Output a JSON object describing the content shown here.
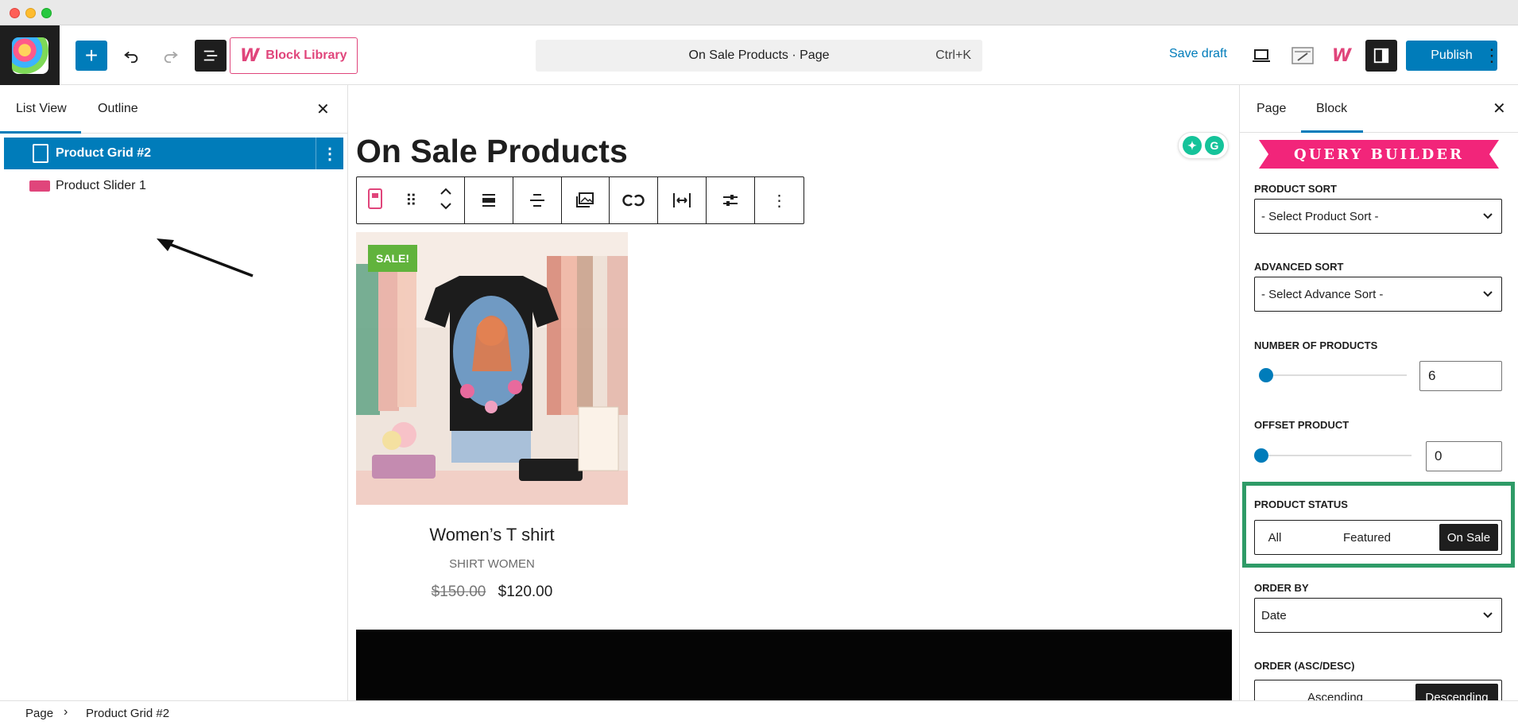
{
  "header": {
    "block_library_label": "Block Library",
    "command_title": "On Sale Products · Page",
    "command_shortcut": "Ctrl+K",
    "save_draft_label": "Save draft",
    "publish_label": "Publish"
  },
  "left_panel": {
    "tabs": [
      "List View",
      "Outline"
    ],
    "items": [
      {
        "label": "Product Grid #2",
        "selected": true
      },
      {
        "label": "Product Slider 1",
        "selected": false
      }
    ]
  },
  "canvas": {
    "page_title": "On Sale Products",
    "product": {
      "badge": "SALE!",
      "name": "Women’s T shirt",
      "categories": "SHIRT  WOMEN",
      "price_old": "$150.00",
      "price_new": "$120.00"
    }
  },
  "right_panel": {
    "tabs": [
      "Page",
      "Block"
    ],
    "banner": "QUERY BUILDER",
    "product_sort": {
      "label": "PRODUCT SORT",
      "value": "- Select Product Sort -"
    },
    "advanced_sort": {
      "label": "ADVANCED SORT",
      "value": "- Select Advance Sort -"
    },
    "number_of_products": {
      "label": "NUMBER OF PRODUCTS",
      "value": "6"
    },
    "offset_product": {
      "label": "OFFSET PRODUCT",
      "value": "0"
    },
    "product_status": {
      "label": "PRODUCT STATUS",
      "options": [
        "All",
        "Featured",
        "On Sale"
      ],
      "selected": "On Sale"
    },
    "order_by": {
      "label": "ORDER BY",
      "value": "Date"
    },
    "order": {
      "label": "ORDER (ASC/DESC)",
      "options": [
        "Ascending",
        "Descending"
      ],
      "selected": "Descending"
    }
  },
  "footer": {
    "breadcrumb": [
      "Page",
      "Product Grid #2"
    ]
  },
  "colors": {
    "accent": "#007cba",
    "brand_pink": "#e0457b",
    "highlight_green": "#2e9b67",
    "sale_green": "#61b33c"
  }
}
